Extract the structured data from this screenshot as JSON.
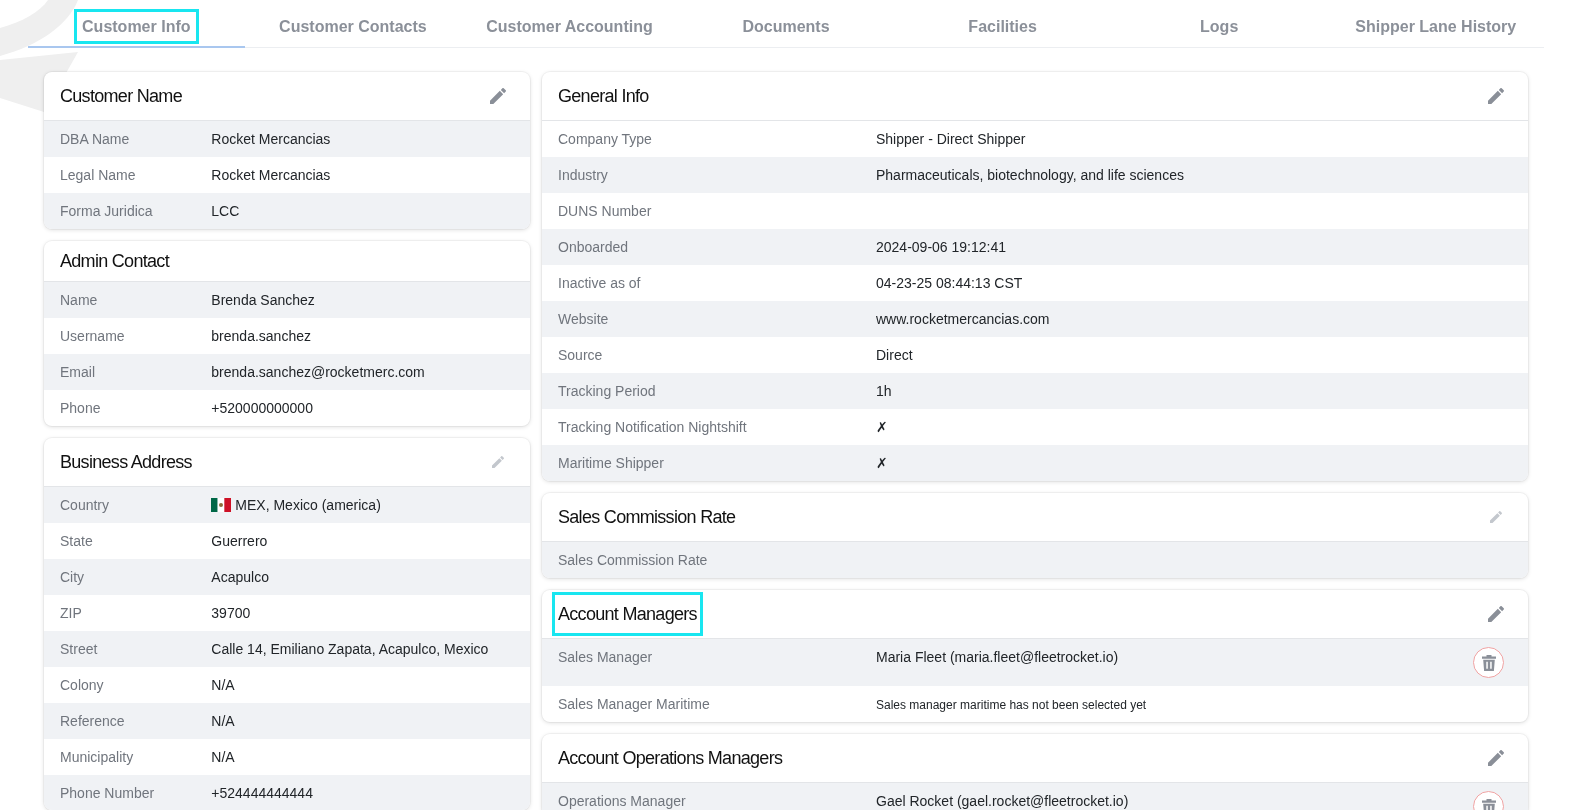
{
  "tabs": [
    {
      "label": "Customer Info",
      "selected": true,
      "highlighted": true
    },
    {
      "label": "Customer Contacts",
      "selected": false,
      "highlighted": false
    },
    {
      "label": "Customer Accounting",
      "selected": false,
      "highlighted": false
    },
    {
      "label": "Documents",
      "selected": false,
      "highlighted": false
    },
    {
      "label": "Facilities",
      "selected": false,
      "highlighted": false
    },
    {
      "label": "Logs",
      "selected": false,
      "highlighted": false
    },
    {
      "label": "Shipper Lane History",
      "selected": false,
      "highlighted": false
    }
  ],
  "left_column": [
    {
      "title": "Customer Name",
      "highlighted": false,
      "first_row_shaded": true,
      "edit_button": {
        "disabled": false
      },
      "rows": [
        {
          "label": "DBA Name",
          "value": "Rocket Mercancias"
        },
        {
          "label": "Legal Name",
          "value": "Rocket Mercancias"
        },
        {
          "label": "Forma Juridica",
          "value": "LCC"
        }
      ]
    },
    {
      "title": "Admin Contact",
      "highlighted": false,
      "first_row_shaded": true,
      "rows": [
        {
          "label": "Name",
          "value": "Brenda Sanchez"
        },
        {
          "label": "Username",
          "value": "brenda.sanchez"
        },
        {
          "label": "Email",
          "value": "brenda.sanchez@rocketmerc.com"
        },
        {
          "label": "Phone",
          "value": "+520000000000"
        }
      ]
    },
    {
      "title": "Business Address",
      "highlighted": false,
      "first_row_shaded": true,
      "edit_button": {
        "disabled": true
      },
      "rows": [
        {
          "kind": "country",
          "label": "Country",
          "value": "MEX, Mexico (america)"
        },
        {
          "kind": "text",
          "label": "State",
          "value": "Guerrero"
        },
        {
          "kind": "text",
          "label": "City",
          "value": "Acapulco"
        },
        {
          "kind": "text",
          "label": "ZIP",
          "value": "39700"
        },
        {
          "kind": "text",
          "label": "Street",
          "value": "Calle 14, Emiliano Zapata, Acapulco, Mexico"
        },
        {
          "kind": "text",
          "label": "Colony",
          "value": "N/A"
        },
        {
          "kind": "text",
          "label": "Reference",
          "value": "N/A"
        },
        {
          "kind": "text",
          "label": "Municipality",
          "value": "N/A"
        },
        {
          "kind": "text",
          "label": "Phone Number",
          "value": "+524444444444"
        }
      ]
    }
  ],
  "right_column": [
    {
      "title": "General Info",
      "highlighted": false,
      "first_row_shaded": false,
      "edit_button": {
        "disabled": false
      },
      "rows": [
        {
          "label": "Company Type",
          "value": "Shipper - Direct Shipper"
        },
        {
          "label": "Industry",
          "value": "Pharmaceuticals, biotechnology, and life sciences"
        },
        {
          "label": "DUNS Number"
        },
        {
          "label": "Onboarded",
          "value": "2024-09-06 19:12:41"
        },
        {
          "label": "Inactive as of",
          "value": "04-23-25 08:44:13 CST"
        },
        {
          "label": "Website",
          "value": "www.rocketmercancias.com"
        },
        {
          "label": "Source",
          "value": "Direct"
        },
        {
          "label": "Tracking Period",
          "value": "1h"
        },
        {
          "label": "Tracking Notification Nightshift",
          "value": "✗"
        },
        {
          "label": "Maritime Shipper",
          "value": "✗"
        }
      ]
    },
    {
      "title": "Sales Commission Rate",
      "highlighted": false,
      "first_row_shaded": true,
      "edit_button": {
        "disabled": true
      },
      "rows": [
        {
          "label": "Sales Commission Rate"
        }
      ]
    },
    {
      "title": "Account Managers",
      "highlighted": true,
      "first_row_shaded": true,
      "edit_button": {
        "disabled": false
      },
      "rows": [
        {
          "kind": "manager",
          "label": "Sales Manager",
          "value": "Maria Fleet (maria.fleet@fleetrocket.io)"
        },
        {
          "kind": "note",
          "label": "Sales Manager Maritime",
          "value": "Sales manager maritime has not been selected yet"
        }
      ]
    },
    {
      "title": "Account Operations Managers",
      "highlighted": false,
      "first_row_shaded": true,
      "edit_button": {
        "disabled": false
      },
      "rows": [
        {
          "kind": "manager",
          "label": "Operations Manager",
          "value": "Gael Rocket (gael.rocket@fleetrocket.io)"
        }
      ]
    }
  ]
}
